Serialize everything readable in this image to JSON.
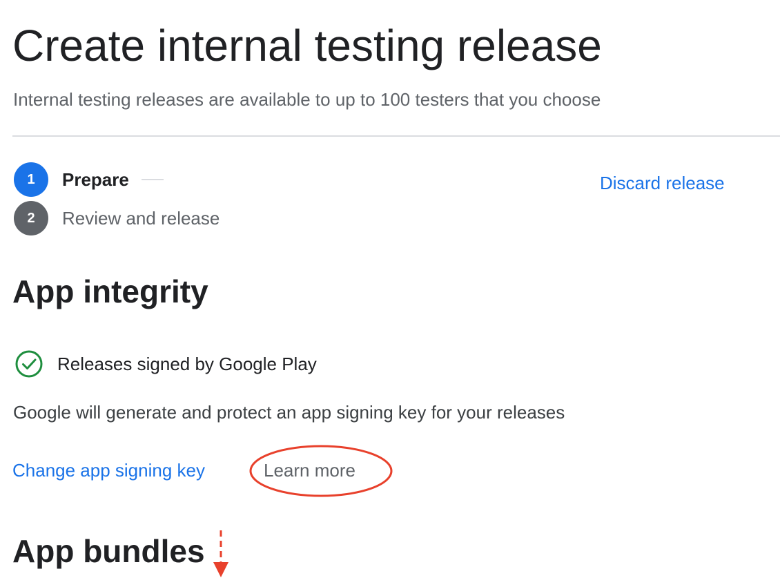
{
  "header": {
    "title": "Create internal testing release",
    "subtitle": "Internal testing releases are available to up to 100 testers that you choose"
  },
  "stepper": {
    "steps": [
      {
        "number": "1",
        "label": "Prepare",
        "state": "active"
      },
      {
        "number": "2",
        "label": "Review and release",
        "state": "pending"
      }
    ]
  },
  "actions": {
    "discard_label": "Discard release"
  },
  "app_integrity": {
    "title": "App integrity",
    "status_icon": "check-circle-icon",
    "status_label": "Releases signed by Google Play",
    "description": "Google will generate and protect an app signing key for your releases",
    "change_key_label": "Change app signing key",
    "learn_more_label": "Learn more"
  },
  "app_bundles": {
    "title": "App bundles"
  },
  "colors": {
    "primary": "#1a73e8",
    "success": "#1e8e3e",
    "annotation": "#e8412c",
    "text": "#202124",
    "secondary_text": "#5f6368",
    "divider": "#dadce0"
  }
}
